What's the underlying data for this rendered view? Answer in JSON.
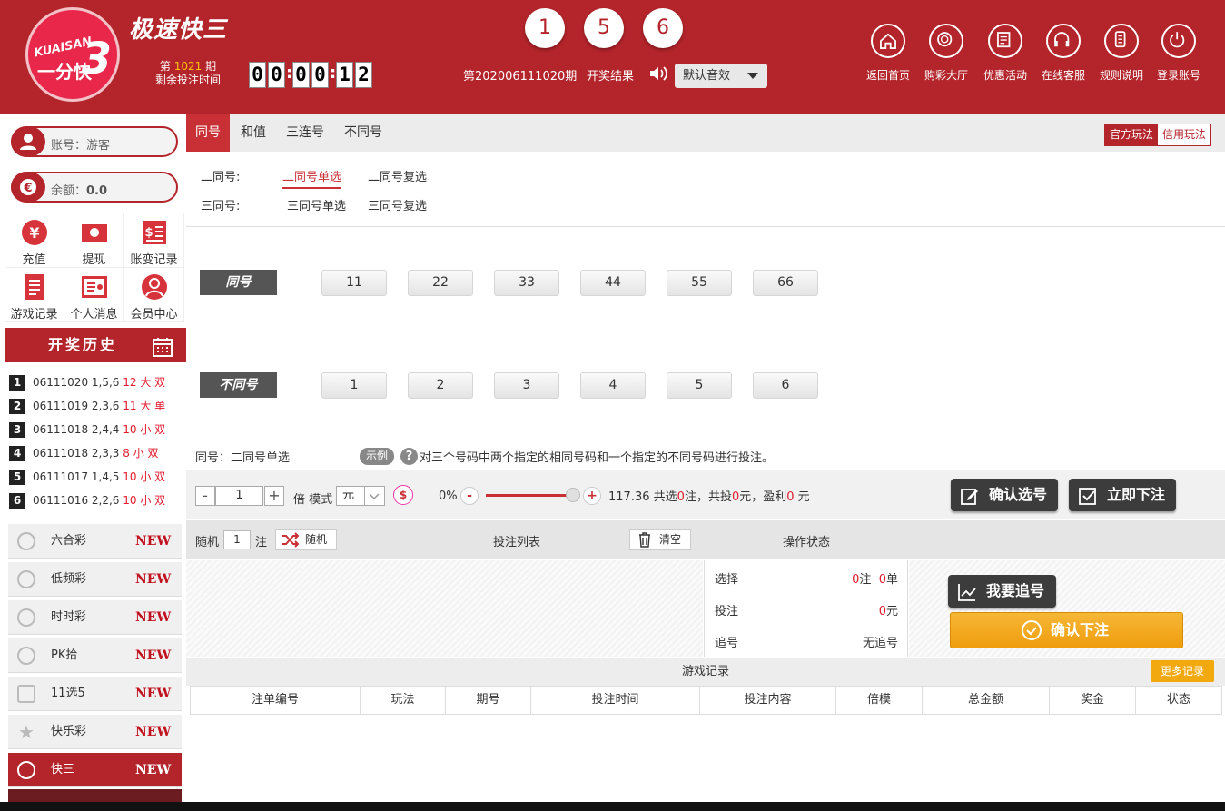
{
  "header": {
    "logo": {
      "line1": "KUAISAN",
      "line2": "一分快",
      "digit": "3"
    },
    "title": "极速快三",
    "issue_prefix": "第",
    "issue_no": "1021",
    "issue_suffix": "期",
    "remain_label": "剩余投注时间",
    "countdown": [
      "0",
      "0",
      "0",
      "0",
      "1",
      "2"
    ],
    "balls": [
      "1",
      "5",
      "6"
    ],
    "result_period": "第202006111020期",
    "result_label": "开奖结果",
    "sound_select": "默认音效",
    "nav": [
      {
        "label": "返回首页",
        "icon": "home-icon"
      },
      {
        "label": "购彩大厅",
        "icon": "lottery-hall-icon"
      },
      {
        "label": "优惠活动",
        "icon": "promotion-icon"
      },
      {
        "label": "在线客服",
        "icon": "headset-icon"
      },
      {
        "label": "规则说明",
        "icon": "rules-icon"
      },
      {
        "label": "登录账号",
        "icon": "power-icon"
      }
    ]
  },
  "sidebar": {
    "account_label": "账号：",
    "account_value": "游客",
    "balance_label": "余额：",
    "balance_value": "0.0",
    "actions": [
      {
        "label": "充值",
        "icon": "yen-coin-icon"
      },
      {
        "label": "提现",
        "icon": "cash-icon"
      },
      {
        "label": "账变记录",
        "icon": "ledger-icon"
      },
      {
        "label": "游戏记录",
        "icon": "document-icon"
      },
      {
        "label": "个人消息",
        "icon": "message-icon"
      },
      {
        "label": "会员中心",
        "icon": "user-icon"
      }
    ],
    "history_title": "开奖历史",
    "history": [
      {
        "n": "1",
        "period": "06111020",
        "nums": "1,5,6",
        "res": "12 大 双"
      },
      {
        "n": "2",
        "period": "06111019",
        "nums": "2,3,6",
        "res": "11 大 单"
      },
      {
        "n": "3",
        "period": "06111018",
        "nums": "2,4,4",
        "res": "10 小 双"
      },
      {
        "n": "4",
        "period": "06111018",
        "nums": "2,3,3",
        "res": "8 小 双"
      },
      {
        "n": "5",
        "period": "06111017",
        "nums": "1,4,5",
        "res": "10 小 双"
      },
      {
        "n": "6",
        "period": "06111016",
        "nums": "2,2,6",
        "res": "10 小 双"
      }
    ],
    "games": [
      {
        "label": "六合彩",
        "badge": "NEW"
      },
      {
        "label": "低频彩",
        "badge": "NEW"
      },
      {
        "label": "时时彩",
        "badge": "NEW"
      },
      {
        "label": "PK拾",
        "badge": "NEW"
      },
      {
        "label": "11选5",
        "badge": "NEW"
      },
      {
        "label": "快乐彩",
        "badge": "NEW"
      },
      {
        "label": "快三",
        "badge": "NEW"
      }
    ]
  },
  "tabs": [
    "同号",
    "和值",
    "三连号",
    "不同号"
  ],
  "mode": {
    "official": "官方玩法",
    "credit": "信用玩法"
  },
  "subplay": {
    "row1_label": "二同号:",
    "row1_opts": [
      "二同号单选",
      "二同号复选"
    ],
    "row2_label": "三同号:",
    "row2_opts": [
      "三同号单选",
      "三同号复选"
    ]
  },
  "picker": {
    "row1_tag": "同号",
    "row1_nums": [
      "11",
      "22",
      "33",
      "44",
      "55",
      "66"
    ],
    "row2_tag": "不同号",
    "row2_nums": [
      "1",
      "2",
      "3",
      "4",
      "5",
      "6"
    ]
  },
  "desc": {
    "prefix": "同号：",
    "play": "二同号单选",
    "example": "示例",
    "q": "?",
    "text": "对三个号码中两个指定的相同号码和一个指定的不同号码进行投注。"
  },
  "betbar": {
    "minus": "-",
    "qty": "1",
    "plus": "+",
    "times_label": "倍 模式",
    "unit": "元",
    "dollar": "$",
    "rebate": "0%",
    "odds": "117.36",
    "s1": "共选",
    "sel": "0",
    "s2": "注，共投",
    "amt": "0",
    "s3": "元，盈利",
    "profit": "0",
    "s4": " 元",
    "confirm_select": "确认选号",
    "bet_now": "立即下注"
  },
  "listbar": {
    "random": "随机",
    "random_count": "1",
    "unit": "注",
    "random_btn": "随机",
    "bet_list": "投注列表",
    "clear": "清空",
    "status": "操作状态"
  },
  "stats": {
    "select_label": "选择",
    "select_count": "0",
    "select_unit1": "注",
    "select_count2": "0",
    "select_unit2": "单",
    "bet_label": "投注",
    "bet_amount": "0",
    "bet_unit": "元",
    "chase_label": "追号",
    "chase_value": "无追号"
  },
  "actions": {
    "chase_btn": "我要追号",
    "confirm_btn": "确认下注"
  },
  "records": {
    "title": "游戏记录",
    "more": "更多记录",
    "columns": [
      "注单编号",
      "玩法",
      "期号",
      "投注时间",
      "投注内容",
      "倍模",
      "总金额",
      "奖金",
      "状态"
    ]
  }
}
